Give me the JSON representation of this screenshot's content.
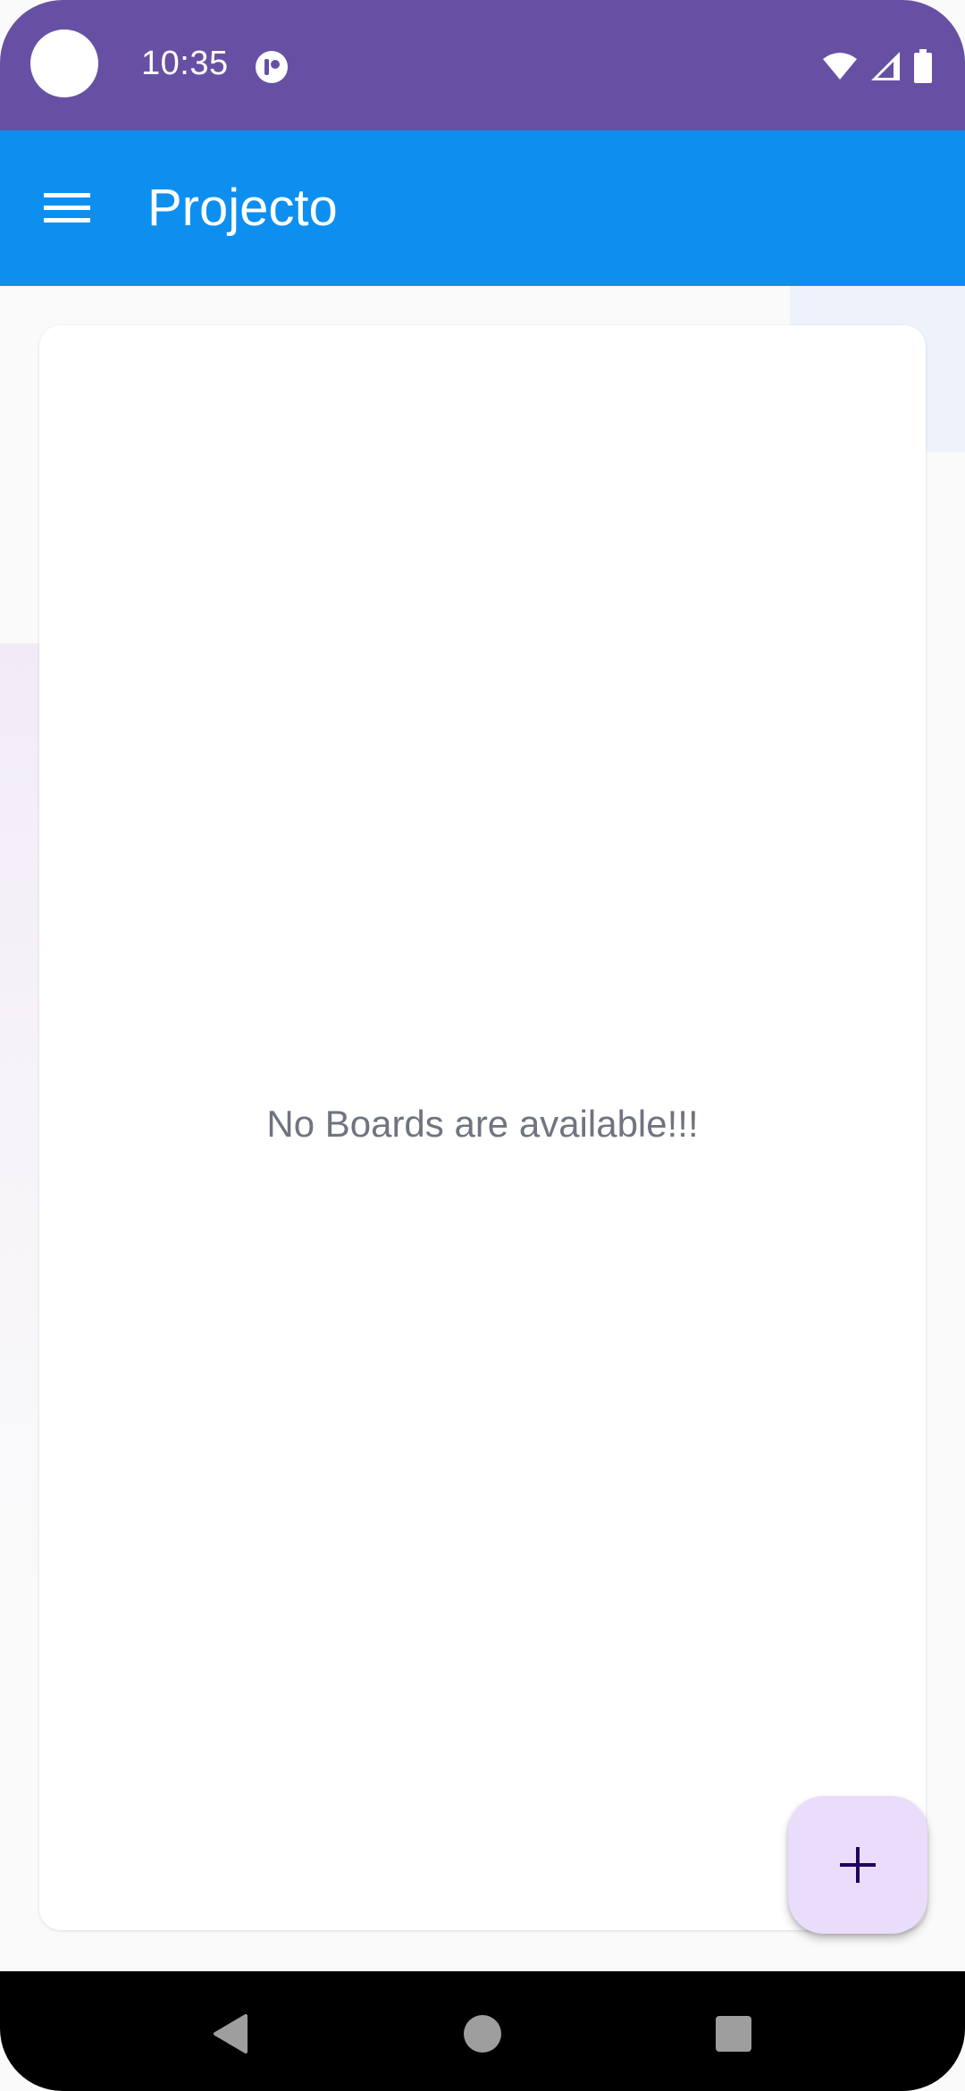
{
  "status_bar": {
    "time": "10:35",
    "icons": [
      "notification-app-icon",
      "wifi-icon",
      "signal-icon",
      "battery-icon"
    ],
    "background_color": "#6750a4"
  },
  "app_bar": {
    "title": "Projecto",
    "menu_icon": "hamburger-menu-icon",
    "background_color": "#0d8ff0"
  },
  "main": {
    "empty_message": "No Boards are available!!!"
  },
  "fab": {
    "icon": "plus-icon",
    "color": "#eadcfb"
  },
  "nav_bar": {
    "buttons": [
      "back-icon",
      "home-icon",
      "recents-icon"
    ]
  }
}
